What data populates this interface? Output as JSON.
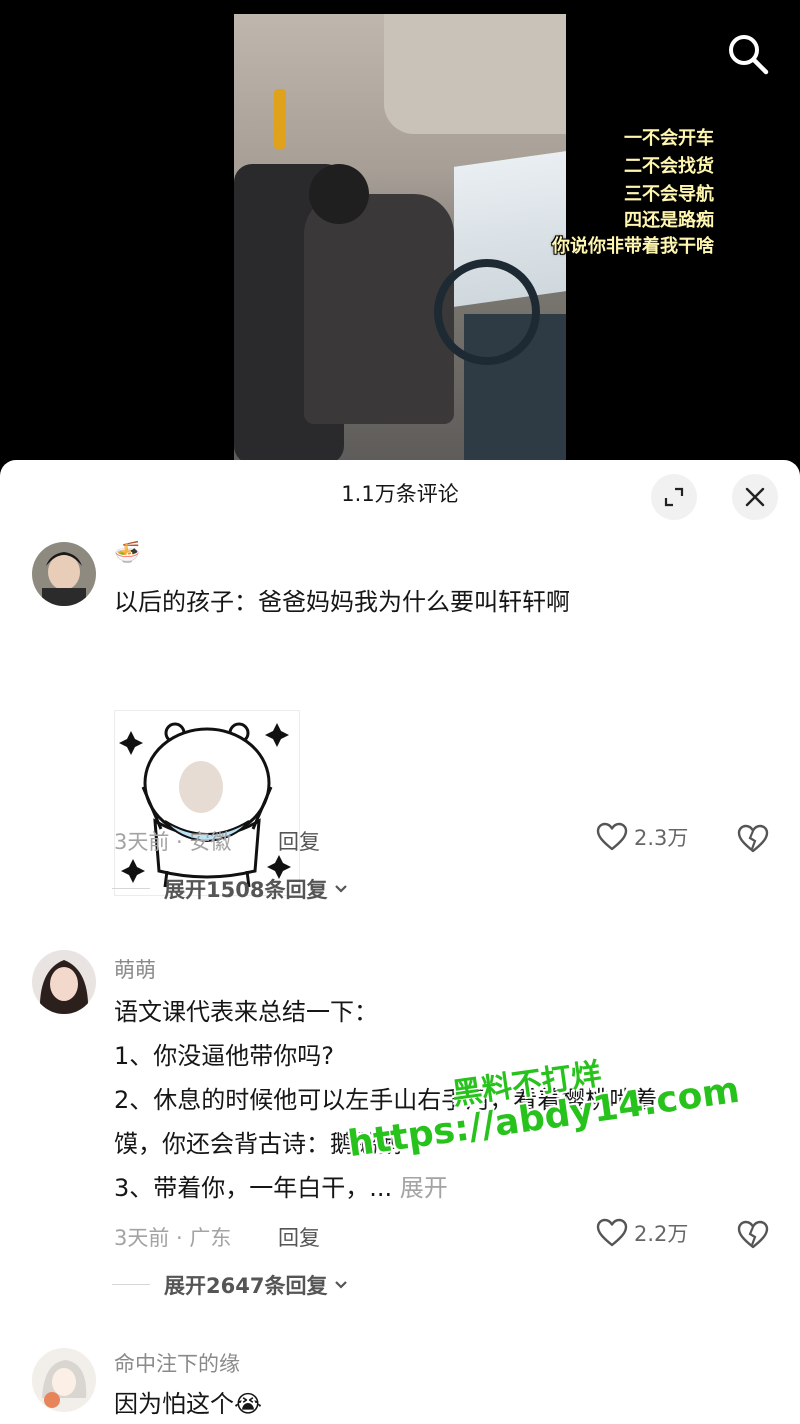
{
  "video": {
    "captions": [
      "一不会开车",
      "二不会找货",
      "三不会导航",
      "四还是路痴",
      "你说你非带着我干啥"
    ]
  },
  "sheet": {
    "title": "1.1万条评论"
  },
  "comments": [
    {
      "username": "🍜",
      "text": "以后的孩子：爸爸妈妈我为什么要叫轩轩啊",
      "time_location": "3天前 · 安徽",
      "reply_label": "回复",
      "likes": "2.3万",
      "expand_label": "展开1508条回复"
    },
    {
      "username": "萌萌",
      "lines": [
        "语文课代表来总结一下：",
        "1、你没逼他带你吗?",
        "2、休息的时候他可以左手山右手河，看着樱桃啃着",
        "馍，你还会背古诗：鹅鹅鹅",
        "3、带着你，一年白干，..."
      ],
      "more_label": "展开",
      "time_location": "3天前 · 广东",
      "reply_label": "回复",
      "likes": "2.2万",
      "expand_label": "展开2647条回复"
    },
    {
      "username": "命中注下的缘",
      "text": "因为怕这个😭"
    }
  ],
  "watermark": {
    "line1": "黑料不打烊",
    "line2": "https://abdy14.com"
  }
}
